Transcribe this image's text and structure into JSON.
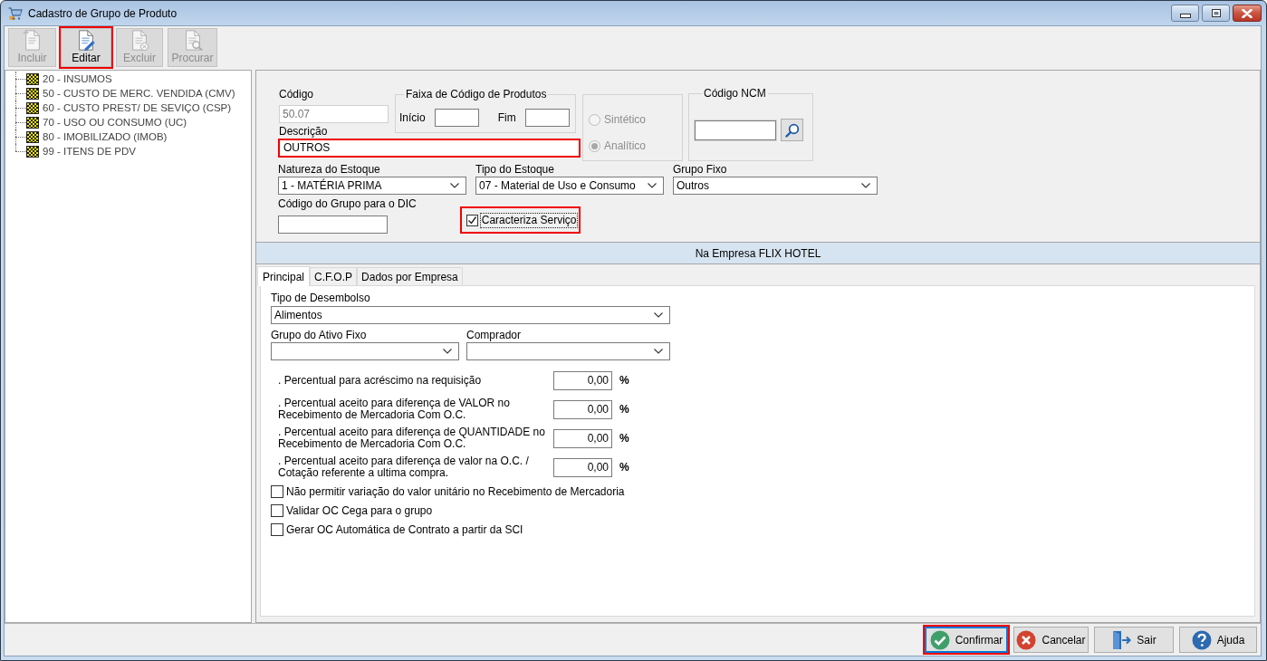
{
  "window": {
    "title": "Cadastro de Grupo de Produto"
  },
  "toolbar": [
    {
      "label": "Incluir",
      "disabled": true,
      "highlighted": false
    },
    {
      "label": "Editar",
      "disabled": false,
      "highlighted": true
    },
    {
      "label": "Excluir",
      "disabled": true,
      "highlighted": false
    },
    {
      "label": "Procurar",
      "disabled": true,
      "highlighted": false
    }
  ],
  "tree": {
    "items": [
      {
        "label": "20 - INSUMOS",
        "selected": false
      },
      {
        "label": "50 - CUSTO DE MERC. VENDIDA (CMV)",
        "selected": false
      },
      {
        "label": "60 - CUSTO PREST/ DE SEVIÇO (CSP)",
        "selected": false
      },
      {
        "label": "70 - USO OU CONSUMO (UC)",
        "selected": false
      },
      {
        "label": "80 - IMOBILIZADO (IMOB)",
        "selected": false
      },
      {
        "label": "99 - ITENS DE PDV",
        "selected": false
      }
    ]
  },
  "form": {
    "codigo": {
      "label": "Código",
      "value": "50.07",
      "disabled": true
    },
    "faixa": {
      "legend": "Faixa de Código de Produtos",
      "start_label": "Início",
      "end_label": "Fim"
    },
    "tipo_grupo": {
      "disabled": true,
      "options": [
        {
          "label": "Sintético",
          "selected": false
        },
        {
          "label": "Analítico",
          "selected": true
        }
      ]
    },
    "ncm": {
      "legend": "Código NCM"
    },
    "descricao": {
      "label": "Descrição",
      "value": "OUTROS",
      "highlighted": true
    },
    "dropdowns": [
      {
        "label": "Natureza do Estoque",
        "value": "1 - MATÉRIA PRIMA"
      },
      {
        "label": "Tipo do Estoque",
        "value": "07 - Material de Uso e Consumo"
      },
      {
        "label": "Grupo Fixo",
        "value": "Outros"
      }
    ],
    "dic": {
      "label": "Código do Grupo para o DIC"
    },
    "caracteriza_servico": {
      "label": "Caracteriza Serviço",
      "checked": true,
      "highlighted": true,
      "focused": true
    }
  },
  "company_band": {
    "text": "Na Empresa FLIX HOTEL"
  },
  "tabs": [
    {
      "label": "Principal",
      "selected": true
    },
    {
      "label": "C.F.O.P",
      "selected": false
    },
    {
      "label": "Dados por Empresa",
      "selected": false
    }
  ],
  "principal": {
    "tipo_desembolso": {
      "label": "Tipo de Desembolso",
      "value": "Alimentos"
    },
    "grupo_ativo": {
      "label": "Grupo do Ativo Fixo"
    },
    "comprador": {
      "label": "Comprador"
    },
    "percentuals": [
      {
        "label": ". Percentual para acréscimo na requisição",
        "value": "0,00",
        "unit": "%"
      },
      {
        "label": ". Percentual aceito para diferença de VALOR no\nRecebimento de Mercadoria Com O.C.",
        "value": "0,00",
        "unit": "%"
      },
      {
        "label": ". Percentual aceito para diferença de QUANTIDADE no\nRecebimento de Mercadoria Com O.C.",
        "value": "0,00",
        "unit": "%"
      },
      {
        "label": ". Percentual aceito para diferença de valor na O.C. /\nCotação referente a ultima compra.",
        "value": "0,00",
        "unit": "%"
      }
    ],
    "options": [
      {
        "label": "Não permitir variação do valor unitário no Recebimento de Mercadoria",
        "checked": false
      },
      {
        "label": "Validar OC Cega para o grupo",
        "checked": false
      },
      {
        "label": "Gerar OC Automática de Contrato a partir da SCI",
        "checked": false
      }
    ]
  },
  "buttons": [
    {
      "label": "Confirmar",
      "highlighted": true,
      "focused": true
    },
    {
      "label": "Cancelar",
      "highlighted": false,
      "focused": false
    },
    {
      "label": "Sair",
      "highlighted": false,
      "focused": false
    },
    {
      "label": "Ajuda",
      "highlighted": false,
      "focused": false
    }
  ]
}
